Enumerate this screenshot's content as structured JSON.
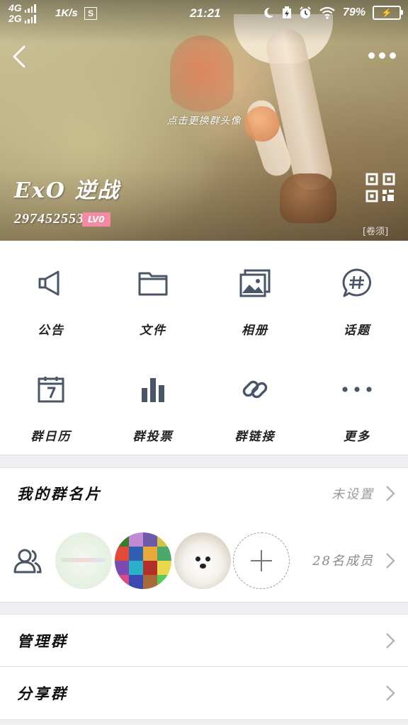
{
  "status_bar": {
    "network_1": "4G",
    "network_2": "2G",
    "speed": "1K/s",
    "sim_badge": "S",
    "time": "21:21",
    "battery_percent": "79%"
  },
  "header": {
    "tap_hint": "点击更换群头像",
    "group_name": "ExO 逆战",
    "group_id": "297452553",
    "level_badge": "LV0",
    "album_tag": "[卷须]"
  },
  "functions": [
    {
      "label": "公告",
      "icon": "megaphone-icon"
    },
    {
      "label": "文件",
      "icon": "folder-icon"
    },
    {
      "label": "相册",
      "icon": "photo-album-icon"
    },
    {
      "label": "话题",
      "icon": "hashtag-bubble-icon"
    },
    {
      "label": "群日历",
      "icon": "calendar-icon"
    },
    {
      "label": "群投票",
      "icon": "bar-chart-icon"
    },
    {
      "label": "群链接",
      "icon": "link-icon"
    },
    {
      "label": "更多",
      "icon": "more-dots-icon"
    }
  ],
  "my_card": {
    "title": "我的群名片",
    "value": "未设置"
  },
  "members": {
    "count_text": "28名成员"
  },
  "manage": {
    "title": "管理群"
  },
  "share": {
    "title": "分享群"
  },
  "colors": {
    "icon_color": "#4a5568",
    "level_badge": "#f48aa3",
    "background": "#efeff4"
  }
}
